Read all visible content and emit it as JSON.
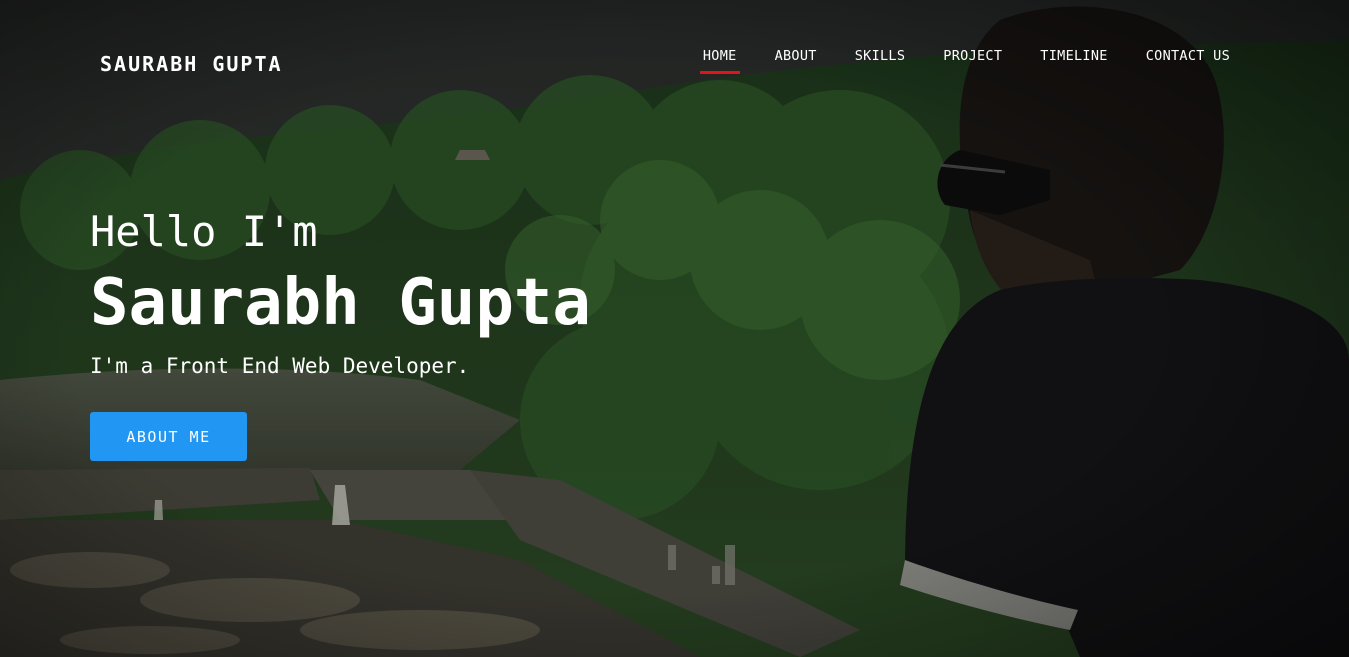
{
  "header": {
    "brand": "SAURABH GUPTA",
    "nav": [
      {
        "label": "HOME",
        "active": true
      },
      {
        "label": "ABOUT",
        "active": false
      },
      {
        "label": "SKILLS",
        "active": false
      },
      {
        "label": "PROJECT",
        "active": false
      },
      {
        "label": "TIMELINE",
        "active": false
      },
      {
        "label": "CONTACT US",
        "active": false
      }
    ]
  },
  "hero": {
    "greeting": "Hello I'm",
    "name": "Saurabh Gupta",
    "tagline": "I'm a Front End Web Developer.",
    "cta_label": "ABOUT ME"
  },
  "colors": {
    "accent": "#2196f3",
    "active_underline": "#e0151a",
    "text": "#ffffff"
  }
}
